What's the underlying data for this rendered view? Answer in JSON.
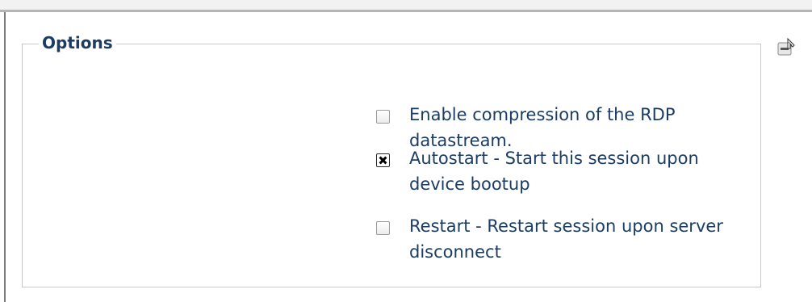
{
  "options": {
    "legend": "Options",
    "items": [
      {
        "label": "Enable compression of the RDP datastream.",
        "checked": false
      },
      {
        "label": "Autostart - Start this session upon device bootup",
        "checked": true
      },
      {
        "label": "Restart - Restart session upon server disconnect",
        "checked": false
      }
    ]
  },
  "icons": {
    "collapse": "collapse-minus-icon",
    "cursor": "hand-pointer-icon"
  },
  "colors": {
    "label_text": "#1c3d63",
    "fieldset_border": "#c8c8c8"
  }
}
